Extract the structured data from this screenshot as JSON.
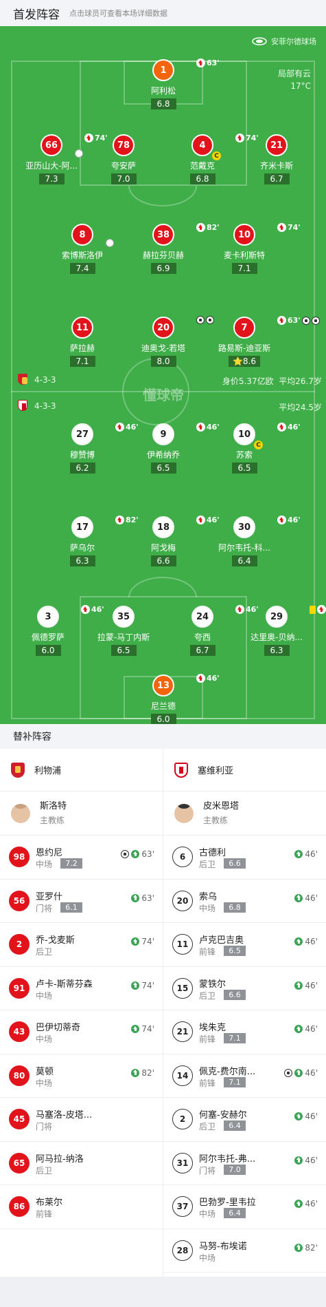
{
  "header": {
    "title": "首发阵容",
    "subtitle": "点击球员可查看本场详细数据"
  },
  "pitch": {
    "stadium": "安菲尔德球场",
    "weather": "局部有云",
    "temperature": "17°C",
    "watermark": "懂球帝",
    "home": {
      "formation": "4-3-3",
      "value_label": "身价5.37亿欧",
      "age_label": "平均26.7岁"
    },
    "away": {
      "formation": "4-3-3",
      "age_label": "平均24.5岁"
    }
  },
  "home_players": [
    {
      "number": "1",
      "name": "阿利松",
      "rating": "6.8",
      "color": "orange",
      "events": [
        {
          "type": "sub-out",
          "minute": "63'"
        }
      ]
    },
    {
      "number": "66",
      "name": "亚历山大-阿...",
      "rating": "7.3",
      "color": "red",
      "events": [
        {
          "type": "sub-out",
          "minute": "74'"
        }
      ],
      "own_marker": true
    },
    {
      "number": "78",
      "name": "夸安萨",
      "rating": "7.0",
      "color": "red",
      "events": []
    },
    {
      "number": "4",
      "name": "范戴克",
      "rating": "6.8",
      "color": "red",
      "captain": true,
      "events": [
        {
          "type": "sub-out",
          "minute": "74'"
        }
      ]
    },
    {
      "number": "21",
      "name": "齐米卡斯",
      "rating": "6.7",
      "color": "red",
      "events": []
    },
    {
      "number": "8",
      "name": "索博斯洛伊",
      "rating": "7.4",
      "color": "red",
      "events": [],
      "own_marker": true
    },
    {
      "number": "38",
      "name": "赫拉芬贝赫",
      "rating": "6.9",
      "color": "red",
      "events": [
        {
          "type": "sub-out",
          "minute": "82'"
        }
      ]
    },
    {
      "number": "10",
      "name": "麦卡利斯特",
      "rating": "7.1",
      "color": "red",
      "events": [
        {
          "type": "sub-out",
          "minute": "74'"
        }
      ]
    },
    {
      "number": "11",
      "name": "萨拉赫",
      "rating": "7.1",
      "color": "red",
      "events": []
    },
    {
      "number": "20",
      "name": "迪奥戈-若塔",
      "rating": "8.0",
      "color": "red",
      "events": [
        {
          "type": "goal"
        },
        {
          "type": "goal"
        }
      ]
    },
    {
      "number": "7",
      "name": "路易斯-迪亚斯",
      "rating": "8.6",
      "color": "red",
      "mvp": true,
      "events": [
        {
          "type": "sub-out",
          "minute": "63'"
        },
        {
          "type": "goal"
        },
        {
          "type": "goal"
        }
      ]
    }
  ],
  "away_players": [
    {
      "number": "27",
      "name": "穆赞博",
      "rating": "6.2",
      "color": "white",
      "events": [
        {
          "type": "sub-out",
          "minute": "46'"
        }
      ]
    },
    {
      "number": "9",
      "name": "伊希纳乔",
      "rating": "6.5",
      "color": "white",
      "events": [
        {
          "type": "sub-out",
          "minute": "46'"
        }
      ]
    },
    {
      "number": "10",
      "name": "苏索",
      "rating": "6.5",
      "color": "white",
      "captain": true,
      "events": [
        {
          "type": "sub-out",
          "minute": "46'"
        }
      ]
    },
    {
      "number": "17",
      "name": "萨乌尔",
      "rating": "6.3",
      "color": "white",
      "events": [
        {
          "type": "sub-out",
          "minute": "82'"
        }
      ]
    },
    {
      "number": "18",
      "name": "阿戈梅",
      "rating": "6.6",
      "color": "white",
      "events": [
        {
          "type": "sub-out",
          "minute": "46'"
        }
      ]
    },
    {
      "number": "30",
      "name": "阿尔韦托-科...",
      "rating": "6.4",
      "color": "white",
      "events": [
        {
          "type": "sub-out",
          "minute": "46'"
        }
      ]
    },
    {
      "number": "3",
      "name": "佩德罗萨",
      "rating": "6.0",
      "color": "white",
      "events": [
        {
          "type": "sub-out",
          "minute": "46'"
        }
      ]
    },
    {
      "number": "35",
      "name": "拉蒙-马丁内斯",
      "rating": "6.5",
      "color": "white",
      "events": []
    },
    {
      "number": "24",
      "name": "夸西",
      "rating": "6.7",
      "color": "white",
      "events": [
        {
          "type": "sub-out",
          "minute": "46'"
        }
      ]
    },
    {
      "number": "29",
      "name": "达里奥-贝纳...",
      "rating": "6.3",
      "color": "white",
      "events": [
        {
          "type": "yellow"
        },
        {
          "type": "sub-out",
          "minute": "46'"
        }
      ]
    },
    {
      "number": "13",
      "name": "尼兰德",
      "rating": "6.0",
      "color": "orange",
      "events": [
        {
          "type": "sub-out",
          "minute": "46'"
        }
      ]
    }
  ],
  "subs": {
    "title": "替补阵容",
    "home": {
      "team": "利物浦",
      "coach": {
        "name": "斯洛特",
        "role": "主教练"
      },
      "players": [
        {
          "number": "98",
          "name": "恩约尼",
          "pos": "中场",
          "rating": "7.2",
          "goal": true,
          "minute": "63'"
        },
        {
          "number": "56",
          "name": "亚罗什",
          "pos": "门将",
          "rating": "6.1",
          "minute": "63'"
        },
        {
          "number": "2",
          "name": "乔-戈麦斯",
          "pos": "后卫",
          "rating": "",
          "minute": "74'"
        },
        {
          "number": "91",
          "name": "卢卡-斯蒂芬森",
          "pos": "中场",
          "rating": "",
          "minute": "74'"
        },
        {
          "number": "43",
          "name": "巴伊切蒂奇",
          "pos": "中场",
          "rating": "",
          "minute": "74'"
        },
        {
          "number": "80",
          "name": "莫顿",
          "pos": "中场",
          "rating": "",
          "minute": "82'"
        },
        {
          "number": "45",
          "name": "马塞洛-皮塔...",
          "pos": "门将",
          "rating": "",
          "minute": ""
        },
        {
          "number": "65",
          "name": "阿马拉-纳洛",
          "pos": "后卫",
          "rating": "",
          "minute": ""
        },
        {
          "number": "86",
          "name": "布莱尔",
          "pos": "前锋",
          "rating": "",
          "minute": ""
        }
      ]
    },
    "away": {
      "team": "塞维利亚",
      "coach": {
        "name": "皮米恩塔",
        "role": "主教练"
      },
      "players": [
        {
          "number": "6",
          "name": "古德利",
          "pos": "后卫",
          "rating": "6.6",
          "minute": "46'"
        },
        {
          "number": "20",
          "name": "索乌",
          "pos": "中场",
          "rating": "6.8",
          "minute": "46'"
        },
        {
          "number": "11",
          "name": "卢克巴吉奥",
          "pos": "前锋",
          "rating": "6.5",
          "minute": "46'"
        },
        {
          "number": "15",
          "name": "蒙铁尔",
          "pos": "后卫",
          "rating": "6.6",
          "minute": "46'"
        },
        {
          "number": "21",
          "name": "埃朱克",
          "pos": "前锋",
          "rating": "7.1",
          "minute": "46'"
        },
        {
          "number": "14",
          "name": "佩克-费尔南...",
          "pos": "前锋",
          "rating": "7.1",
          "goal": true,
          "minute": "46'"
        },
        {
          "number": "2",
          "name": "何塞-安赫尔",
          "pos": "后卫",
          "rating": "6.4",
          "minute": "46'"
        },
        {
          "number": "31",
          "name": "阿尔韦托-弗...",
          "pos": "门将",
          "rating": "7.0",
          "minute": "46'"
        },
        {
          "number": "37",
          "name": "巴勃罗-里韦拉",
          "pos": "中场",
          "rating": "6.4",
          "minute": "46'"
        },
        {
          "number": "28",
          "name": "马努-布埃诺",
          "pos": "中场",
          "rating": "",
          "minute": "82'"
        }
      ]
    }
  },
  "colors": {
    "pitch": "#3fae49",
    "home": "#e2131a",
    "keeper": "#f3640b",
    "rating_bg": "#2b6f2c",
    "sub_in": "#3aa655"
  }
}
